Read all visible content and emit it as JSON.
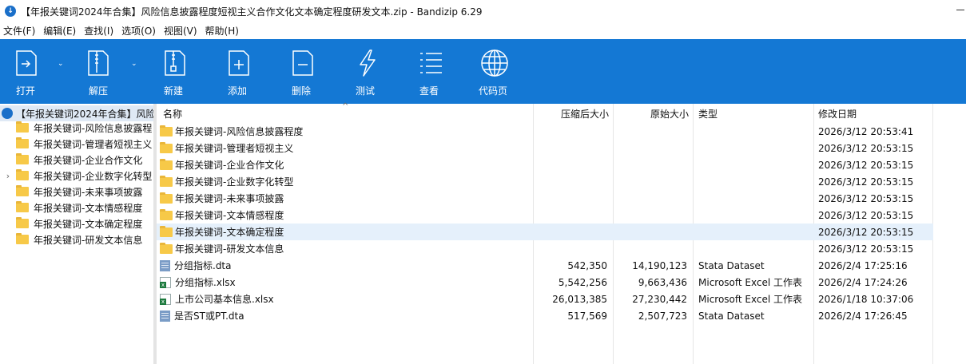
{
  "window": {
    "title": "【年报关键词2024年合集】风险信息披露程度短视主义合作文化文本确定程度研发文本.zip - Bandizip 6.29"
  },
  "menu": [
    "文件(F)",
    "编辑(E)",
    "查找(I)",
    "选项(O)",
    "视图(V)",
    "帮助(H)"
  ],
  "toolbar": {
    "open": "打开",
    "extract": "解压",
    "new": "新建",
    "add": "添加",
    "delete": "删除",
    "test": "测试",
    "view": "查看",
    "codepage": "代码页"
  },
  "tree": {
    "root": "【年报关键词2024年合集】风险",
    "items": [
      "年报关键词-风险信息披露程",
      "年报关键词-管理者短视主义",
      "年报关键词-企业合作文化",
      "年报关键词-企业数字化转型",
      "年报关键词-未来事项披露",
      "年报关键词-文本情感程度",
      "年报关键词-文本确定程度",
      "年报关键词-研发文本信息"
    ]
  },
  "columns": {
    "name": "名称",
    "compressed": "压缩后大小",
    "original": "原始大小",
    "type": "类型",
    "modified": "修改日期"
  },
  "files": [
    {
      "name": "年报关键词-风险信息披露程度",
      "compressed": "",
      "original": "",
      "type": "",
      "modified": "2026/3/12 20:53:41",
      "icon": "folder-icon"
    },
    {
      "name": "年报关键词-管理者短视主义",
      "compressed": "",
      "original": "",
      "type": "",
      "modified": "2026/3/12 20:53:15",
      "icon": "folder-icon"
    },
    {
      "name": "年报关键词-企业合作文化",
      "compressed": "",
      "original": "",
      "type": "",
      "modified": "2026/3/12 20:53:15",
      "icon": "folder-icon"
    },
    {
      "name": "年报关键词-企业数字化转型",
      "compressed": "",
      "original": "",
      "type": "",
      "modified": "2026/3/12 20:53:15",
      "icon": "folder-icon"
    },
    {
      "name": "年报关键词-未来事项披露",
      "compressed": "",
      "original": "",
      "type": "",
      "modified": "2026/3/12 20:53:15",
      "icon": "folder-icon"
    },
    {
      "name": "年报关键词-文本情感程度",
      "compressed": "",
      "original": "",
      "type": "",
      "modified": "2026/3/12 20:53:15",
      "icon": "folder-icon"
    },
    {
      "name": "年报关键词-文本确定程度",
      "compressed": "",
      "original": "",
      "type": "",
      "modified": "2026/3/12 20:53:15",
      "icon": "folder-icon"
    },
    {
      "name": "年报关键词-研发文本信息",
      "compressed": "",
      "original": "",
      "type": "",
      "modified": "2026/3/12 20:53:15",
      "icon": "folder-icon"
    },
    {
      "name": "分组指标.dta",
      "compressed": "542,350",
      "original": "14,190,123",
      "type": "Stata Dataset",
      "modified": "2026/2/4 17:25:16",
      "icon": "dta-file-icon"
    },
    {
      "name": "分组指标.xlsx",
      "compressed": "5,542,256",
      "original": "9,663,436",
      "type": "Microsoft Excel 工作表",
      "modified": "2026/2/4 17:24:26",
      "icon": "excel-file-icon"
    },
    {
      "name": "上市公司基本信息.xlsx",
      "compressed": "26,013,385",
      "original": "27,230,442",
      "type": "Microsoft Excel 工作表",
      "modified": "2026/1/18 10:37:06",
      "icon": "excel-file-icon"
    },
    {
      "name": "是否ST或PT.dta",
      "compressed": "517,569",
      "original": "2,507,723",
      "type": "Stata Dataset",
      "modified": "2026/2/4 17:26:45",
      "icon": "dta-file-icon"
    }
  ],
  "selected_row": 6
}
